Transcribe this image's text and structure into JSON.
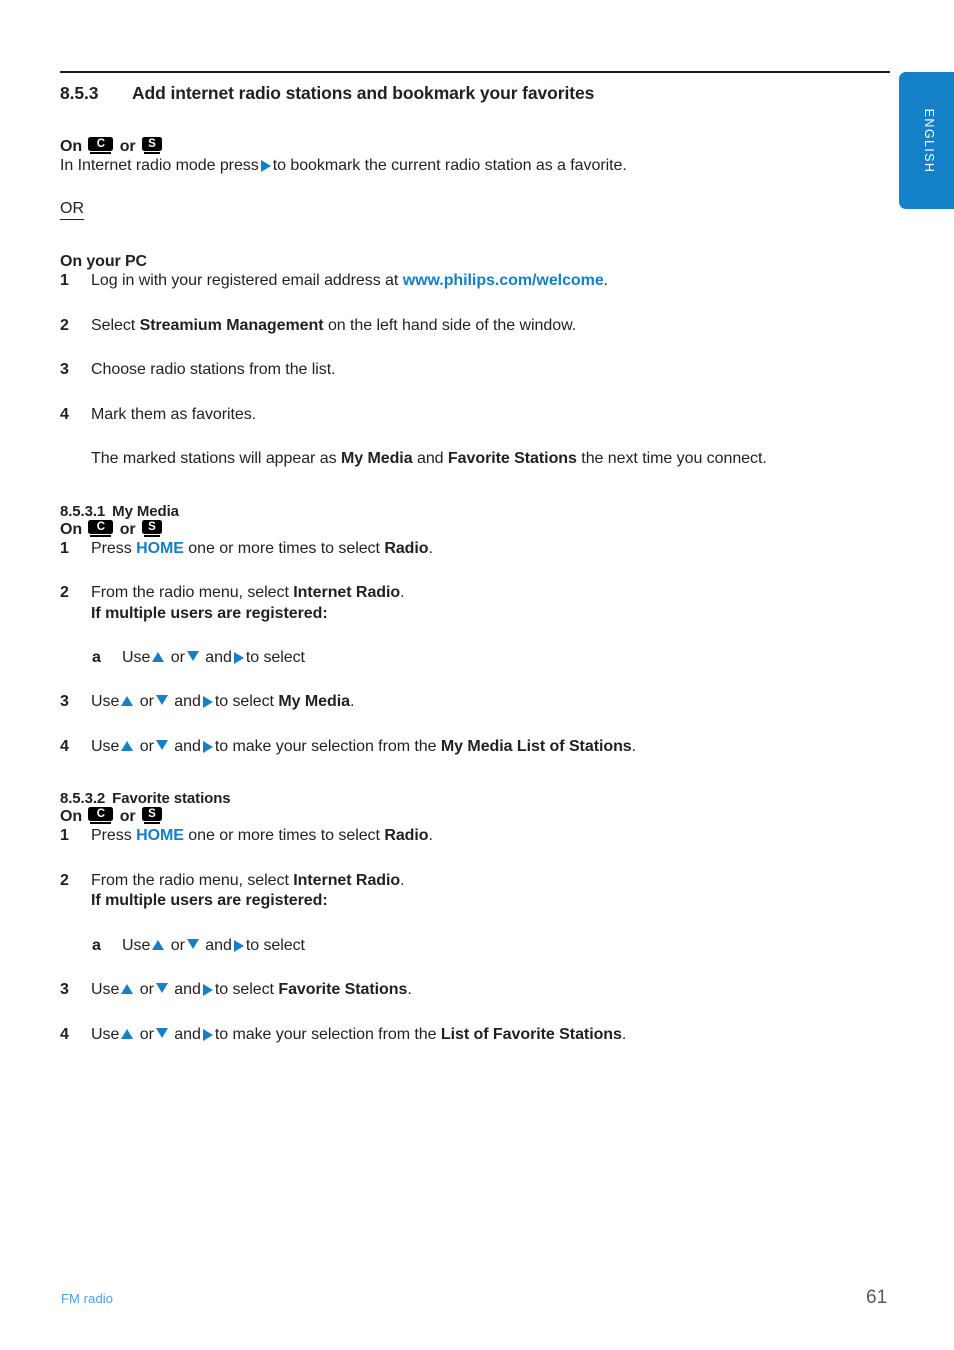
{
  "side_tab": {
    "label": "ENGLISH",
    "color": "#1380c8"
  },
  "section": {
    "number": "8.5.3",
    "title": "Add internet radio stations and bookmark your favorites"
  },
  "on_device": {
    "prefix": "On",
    "conjunction": "or",
    "badge_c": "C",
    "badge_s": "S"
  },
  "intro": {
    "text_before_arrow": "In Internet radio mode press",
    "text_after_arrow": "to bookmark the current radio station as a favorite."
  },
  "or_divider": "OR",
  "pc_section": {
    "heading": "On your PC",
    "steps": [
      {
        "marker": "1",
        "before": "Log in with your registered email address at",
        "link": "www.philips.com/welcome",
        "after": "."
      },
      {
        "marker": "2",
        "before": "Select",
        "bold": "Streamium Management",
        "after": "on the left hand side of the window."
      },
      {
        "marker": "3",
        "text": "Choose radio stations from the list."
      },
      {
        "marker": "4",
        "text": "Mark them as favorites."
      }
    ],
    "note": {
      "before": "The marked stations will appear as",
      "bold1": "My Media",
      "middle": "and",
      "bold2": "Favorite Stations",
      "after": "the next time you connect."
    }
  },
  "my_media_section": {
    "number": "8.5.3.1",
    "title": "My Media",
    "steps": [
      {
        "marker": "1",
        "before": "Press",
        "key": "HOME",
        "middle": "one or more times to select",
        "bold": "Radio",
        "after": "."
      },
      {
        "marker": "2",
        "before": "From the radio menu, select",
        "bold": "Internet Radio",
        "after": ".",
        "second_line": "If multiple users are registered:"
      },
      {
        "marker": "a",
        "sub": true,
        "before": "Use",
        "mid1": "or",
        "mid2": "and",
        "after": "to select"
      },
      {
        "marker": "3",
        "before": "Use",
        "mid1": "or",
        "mid2": "and",
        "mid3": "to select",
        "bold": "My Media",
        "after": "."
      },
      {
        "marker": "4",
        "before": "Use",
        "mid1": "or",
        "mid2": "and",
        "mid3": "to make your selection from the",
        "bold": "My Media List of Stations",
        "after": "."
      }
    ]
  },
  "favorites_section": {
    "number": "8.5.3.2",
    "title": "Favorite stations",
    "steps": [
      {
        "marker": "1",
        "before": "Press",
        "key": "HOME",
        "middle": "one or more times to select",
        "bold": "Radio",
        "after": "."
      },
      {
        "marker": "2",
        "before": "From the radio menu, select",
        "bold": "Internet Radio",
        "after": ".",
        "second_line": "If multiple users are registered:"
      },
      {
        "marker": "a",
        "sub": true,
        "before": "Use",
        "mid1": "or",
        "mid2": "and",
        "after": "to select"
      },
      {
        "marker": "3",
        "before": "Use",
        "mid1": "or",
        "mid2": "and",
        "mid3": "to select",
        "bold": "Favorite Stations",
        "after": "."
      },
      {
        "marker": "4",
        "before": "Use",
        "mid1": "or",
        "mid2": "and",
        "mid3": "to make your selection from the",
        "bold": "List of Favorite Stations",
        "after": "."
      }
    ]
  },
  "footer": {
    "chapter": "FM radio",
    "page_number": "61"
  }
}
